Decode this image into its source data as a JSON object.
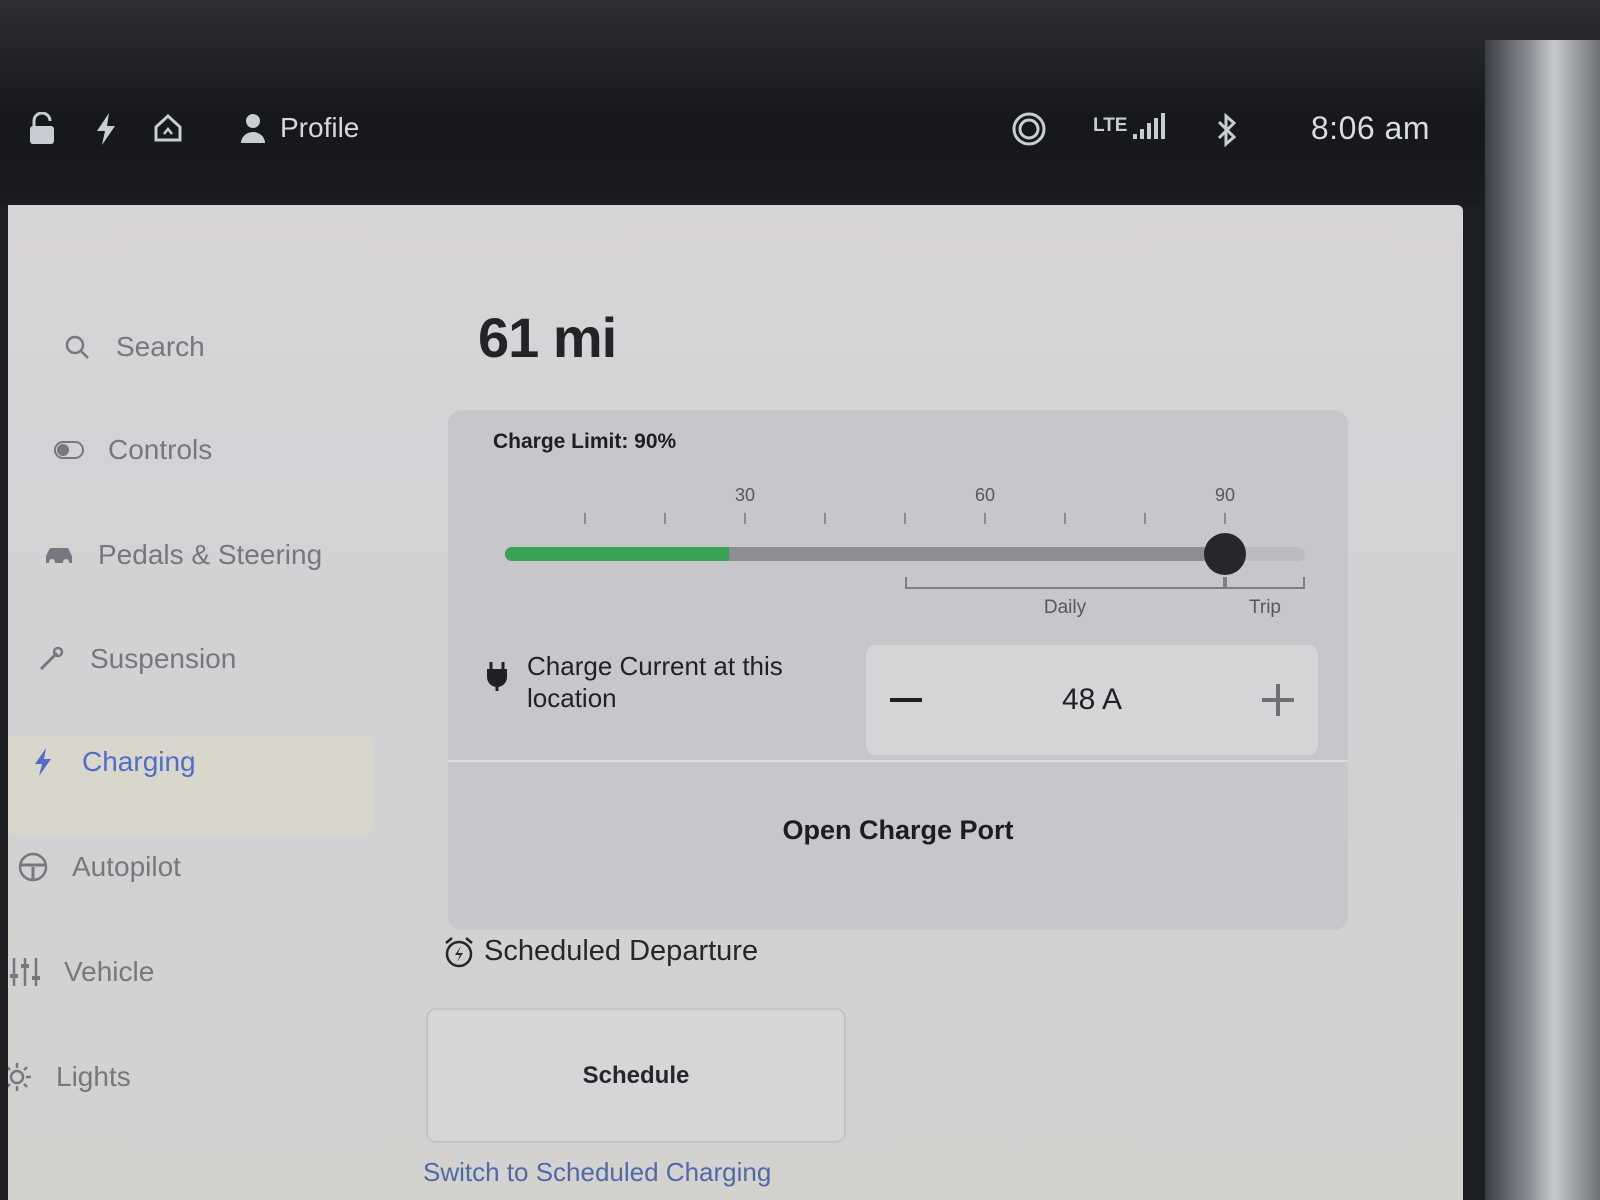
{
  "status_bar": {
    "profile_label": "Profile",
    "network": "LTE",
    "clock": "8:06 am",
    "icons": [
      "lock-icon",
      "bolt-icon",
      "home-icon",
      "person-icon",
      "record-icon",
      "signal-icon",
      "bluetooth-icon"
    ]
  },
  "sidebar": {
    "items": [
      {
        "label": "Search",
        "icon": "search-icon"
      },
      {
        "label": "Controls",
        "icon": "toggle-icon"
      },
      {
        "label": "Pedals & Steering",
        "icon": "car-icon"
      },
      {
        "label": "Suspension",
        "icon": "wrench-icon"
      },
      {
        "label": "Charging",
        "icon": "bolt-icon",
        "active": true
      },
      {
        "label": "Autopilot",
        "icon": "steering-wheel-icon"
      },
      {
        "label": "Vehicle",
        "icon": "sliders-icon"
      },
      {
        "label": "Lights",
        "icon": "sun-icon"
      }
    ]
  },
  "charging": {
    "range": "61 mi",
    "charge_limit_label": "Charge Limit: 90%",
    "charge_limit_percent": 90,
    "current_charge_percent": 28,
    "tick_labels": [
      "30",
      "60",
      "90"
    ],
    "daily_label": "Daily",
    "trip_label": "Trip",
    "charge_current_label": "Charge Current at this location",
    "charge_current_value": "48 A",
    "open_port_label": "Open Charge Port"
  },
  "schedule": {
    "title": "Scheduled Departure",
    "button_label": "Schedule",
    "switch_link": "Switch to Scheduled Charging"
  },
  "colors": {
    "accent_blue": "#4f6ec8",
    "charge_green": "#3aa254",
    "knob": "#25272b"
  }
}
